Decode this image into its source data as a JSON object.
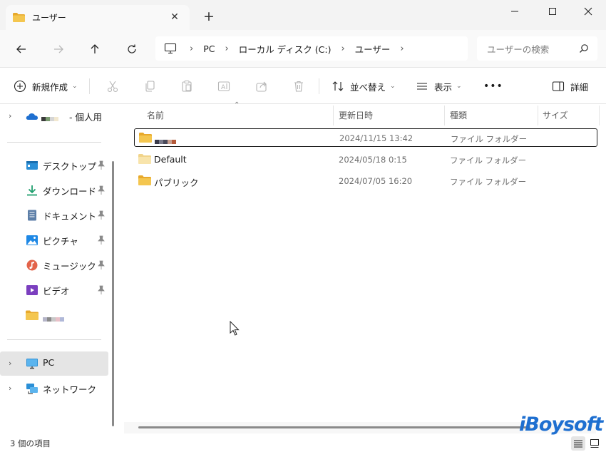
{
  "window": {
    "tab_title": "ユーザー",
    "new_tab_glyph": "+",
    "close_tab_glyph": "✕",
    "controls": {
      "minimize": "—",
      "maximize": "☐",
      "close": "✕"
    }
  },
  "address": {
    "crumbs": [
      "PC",
      "ローカル ディスク (C:)",
      "ユーザー"
    ],
    "search_placeholder": "ユーザーの検索"
  },
  "commands": {
    "new_label": "新規作成",
    "sort_label": "並べ替え",
    "view_label": "表示",
    "more_label": "•••",
    "details_label": "詳細"
  },
  "sidebar": {
    "onedrive_label": "- 個人用",
    "quick_access": [
      {
        "label": "デスクトップ",
        "icon": "desktop-icon"
      },
      {
        "label": "ダウンロード",
        "icon": "download-icon"
      },
      {
        "label": "ドキュメント",
        "icon": "documents-icon"
      },
      {
        "label": "ピクチャ",
        "icon": "pictures-icon"
      },
      {
        "label": "ミュージック",
        "icon": "music-icon"
      },
      {
        "label": "ビデオ",
        "icon": "videos-icon"
      }
    ],
    "pc_label": "PC",
    "network_label": "ネットワーク"
  },
  "columns": {
    "name": "名前",
    "modified": "更新日時",
    "type": "種類",
    "size": "サイズ"
  },
  "files": [
    {
      "name": "",
      "modified": "2024/11/15 13:42",
      "type": "ファイル フォルダー",
      "selected": true
    },
    {
      "name": "Default",
      "modified": "2024/05/18 0:15",
      "type": "ファイル フォルダー",
      "selected": false
    },
    {
      "name": "パブリック",
      "modified": "2024/07/05 16:20",
      "type": "ファイル フォルダー",
      "selected": false
    }
  ],
  "status": {
    "item_count": "3 個の項目"
  },
  "watermark": "iBoysoft",
  "colors": {
    "folder": "#f4c64f",
    "folder_back": "#e8a92b",
    "accent": "#1e6fd0"
  }
}
